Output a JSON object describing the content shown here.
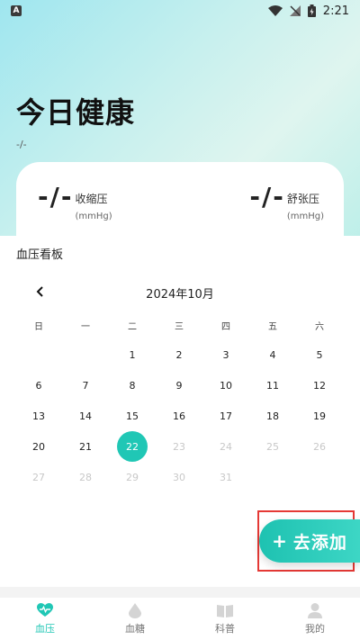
{
  "status_bar": {
    "time": "2:21"
  },
  "header": {
    "title": "今日健康",
    "date": "-/-"
  },
  "summary": {
    "systolic": {
      "value": "-/-",
      "label": "收缩压",
      "unit": "(mmHg)"
    },
    "diastolic": {
      "value": "-/-",
      "label": "舒张压",
      "unit": "(mmHg)"
    }
  },
  "panel": {
    "title": "血压看板"
  },
  "calendar": {
    "month_label": "2024年10月",
    "weekdays": [
      "日",
      "一",
      "二",
      "三",
      "四",
      "五",
      "六"
    ],
    "selected_day": "22",
    "weeks": [
      [
        "",
        "",
        "1",
        "2",
        "3",
        "4",
        "5"
      ],
      [
        "6",
        "7",
        "8",
        "9",
        "10",
        "11",
        "12"
      ],
      [
        "13",
        "14",
        "15",
        "16",
        "17",
        "18",
        "19"
      ],
      [
        "20",
        "21",
        "22",
        "23",
        "24",
        "25",
        "26"
      ],
      [
        "27",
        "28",
        "29",
        "30",
        "31",
        "",
        ""
      ]
    ],
    "future_days": [
      "23",
      "24",
      "25",
      "26",
      "27",
      "28",
      "29",
      "30",
      "31"
    ]
  },
  "fab": {
    "label": "去添加"
  },
  "tabs": [
    {
      "label": "血压",
      "icon": "heart-pulse-icon",
      "active": true
    },
    {
      "label": "血糖",
      "icon": "drop-icon",
      "active": false
    },
    {
      "label": "科普",
      "icon": "book-icon",
      "active": false
    },
    {
      "label": "我的",
      "icon": "person-icon",
      "active": false
    }
  ],
  "colors": {
    "accent": "#20c7b5",
    "highlight_frame": "#e53935"
  }
}
